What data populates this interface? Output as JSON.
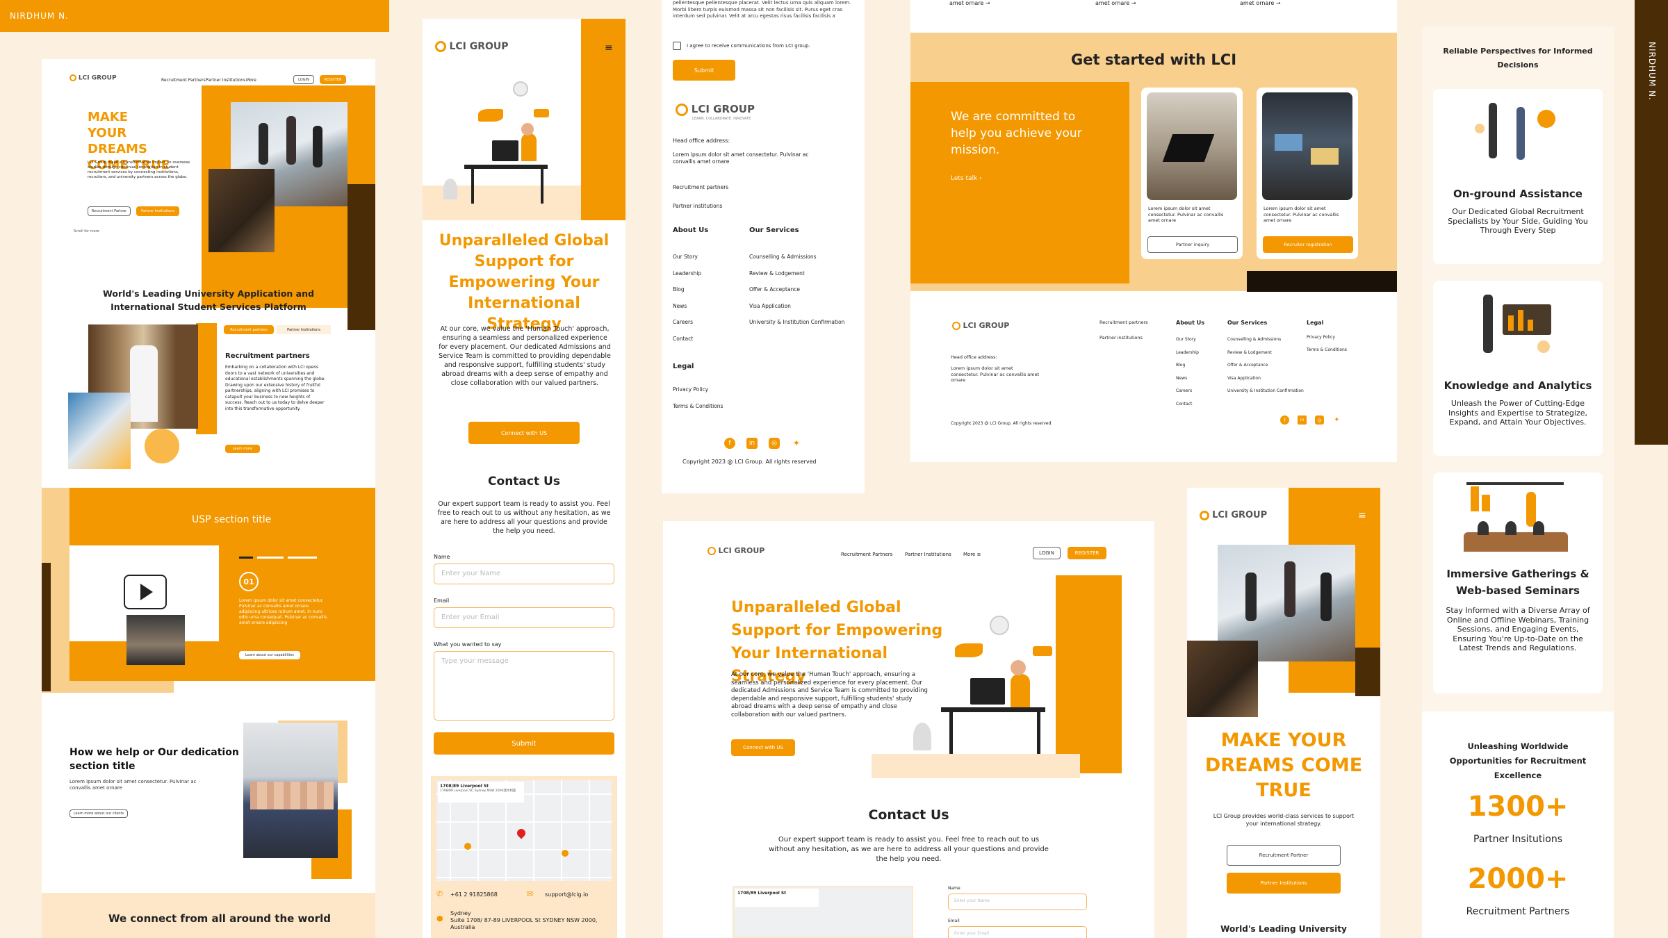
{
  "author": "NIRDHUM N.",
  "brand": {
    "name": "LCI GROUP",
    "tagline": "LEARN. COLLABORATE. INNOVATE"
  },
  "nav": {
    "recruitment": "Recruitment Partners",
    "partner": "Partner Institutions",
    "more": "More",
    "login": "LOGIN",
    "register": "REGISTER"
  },
  "hero": {
    "title": "MAKE YOUR DREAMS COME TRUE",
    "desc": "LCI Group make a transformative impact on overseas studies through continual innovation in student recruitment services by connecting institutions, recruiters, and university partners across the globe.",
    "btn1": "Recruitment Partner",
    "btn2": "Partner Institutions",
    "scroll": "Scroll for more"
  },
  "world": {
    "title": "World's Leading University Application and International Student Services Platform",
    "tab1": "Recruitment partners",
    "tab2": "Partner Institutions",
    "heading": "Recruitment partners",
    "body": "Embarking on a collaboration with LCI opens doors to a vast network of universities and educational establishments spanning the globe. Drawing upon our extensive history of fruitful partnerships, aligning with LCI promises to catapult your business to new heights of success. Reach out to us today to delve deeper into this transformative opportunity.",
    "btn": "Learn more"
  },
  "usp": {
    "title": "USP section title",
    "num": "01",
    "body": "Lorem ipsum dolor sit amet consectetur. Pulvinar ac convallis amet ornare adipiscing ultrices rutrum amet. In nunc odio urna consequat. Pulvinar ac convallis amet ornare adipiscing",
    "btn": "Learn about our capabilities"
  },
  "help": {
    "title": "How we help or Our dedication section title",
    "body": "Lorem ipsum dolor sit amet consectetur. Pulvinar ac convallis amet ornare",
    "btn": "Learn more about our clients"
  },
  "connect": {
    "title": "We connect from all around the world"
  },
  "unparalleled": {
    "title": "Unparalleled Global Support for Empowering Your International Strategy",
    "body": "At our core, we value the 'Human Touch' approach, ensuring a seamless and personalized experience for every placement. Our dedicated Admissions and Service Team is committed to providing dependable and responsive support, fulfilling students' study abroad dreams with a deep sense of empathy and close collaboration with our valued partners.",
    "btn": "Connect with US"
  },
  "contact": {
    "title": "Contact Us",
    "body": "Our expert support team is ready to assist you. Feel free to reach out to us without any hesitation, as we are here to address all your questions and provide the help you need.",
    "name_label": "Name",
    "name_ph": "Enter your Name",
    "email_label": "Email",
    "email_ph": "Enter your Email",
    "msg_label": "What you wanted to say",
    "msg_ph": "Type your message",
    "submit": "Submit",
    "phone": "+61 2 91825868",
    "email": "support@lcig.io",
    "city": "Sydney",
    "address": "Suite 1708/ 87-89 LIVERPOOL St SYDNEY NSW 2000, Australia",
    "map_title": "1708/89 Liverpool St",
    "map_sub": "1708/89 Liverpool St, Sydney NSW 2000澳大利亚"
  },
  "form_top": {
    "text": "pellentesque pellentesque placerat. Velit lectus urna quis aliquam lorem. Morbi libero turpis euismod massa sit non facilisis sit. Purus eget cras interdum sed pulvinar. Velit at arcu egestas risus facilisis facilisis a",
    "consent": "I agree to receive communications from LCI group.",
    "submit": "Submit"
  },
  "footer": {
    "office_label": "Head office address:",
    "office": "Lorem ipsum dolor sit amet consectetur. Pulvinar ac convallis amet ornare",
    "links": [
      "Recruitment partners",
      "Partner institutions"
    ],
    "about_title": "About Us",
    "about": [
      "Our Story",
      "Leadership",
      "Blog",
      "News",
      "Careers",
      "Contact"
    ],
    "services_title": "Our Services",
    "services": [
      "Counselling & Admissions",
      "Review & Lodgement",
      "Offer & Acceptance",
      "Visa Application",
      "University & Institution Confirmation"
    ],
    "legal_title": "Legal",
    "legal": [
      "Privacy Policy",
      "Terms & Conditions"
    ],
    "copyright": "Copyright 2023 @ LCI Group. All rights reserved",
    "copyright2": "Copyright 2023 @ LCI Group. All rights reserved"
  },
  "started": {
    "arrow_text": "amet ornare",
    "title": "Get started with LCI",
    "mission": "We are committed to help you achieve your mission.",
    "lets": "Lets talk",
    "card1": "Lorem ipsum dolor sit amet consectetur. Pulvinar ac convallis amet ornare",
    "card1_btn": "Partner inquiry",
    "card2": "Lorem ipsum dolor sit amet consectetur. Pulvinar ac convallis amet ornare",
    "card2_btn": "Recruiter registration"
  },
  "mobile_hero": {
    "title": "MAKE YOUR DREAMS COME TRUE",
    "desc": "LCI Group provides world-class services to support your international strategy.",
    "btn1": "Recruitment Partner",
    "btn2": "Partner Institutions",
    "world": "World's Leading University"
  },
  "features": {
    "header": "Reliable Perspectives for Informed Decisions",
    "items": [
      {
        "title": "On-ground Assistance",
        "body": "Our Dedicated Global Recruitment Specialists by Your Side, Guiding You Through Every Step"
      },
      {
        "title": "Knowledge and Analytics",
        "body": "Unleash the Power of Cutting-Edge Insights and Expertise to Strategize, Expand, and Attain Your Objectives."
      },
      {
        "title": "Immersive Gatherings & Web-based Seminars",
        "body": "Stay Informed with a Diverse Array of Online and Offline Webinars, Training Sessions, and Engaging Events, Ensuring You're Up-to-Date on the Latest Trends and Regulations."
      }
    ],
    "opp": "Unleashing Worldwide Opportunities for Recruitment Excellence",
    "stat1": "1300+",
    "stat1_label": "Partner Insitutions",
    "stat2": "2000+",
    "stat2_label": "Recruitment Partners"
  },
  "colors": {
    "orange": "#f39800",
    "light": "#f9cf8e",
    "dark": "#4a2c07",
    "bg": "#fcf0e1"
  }
}
